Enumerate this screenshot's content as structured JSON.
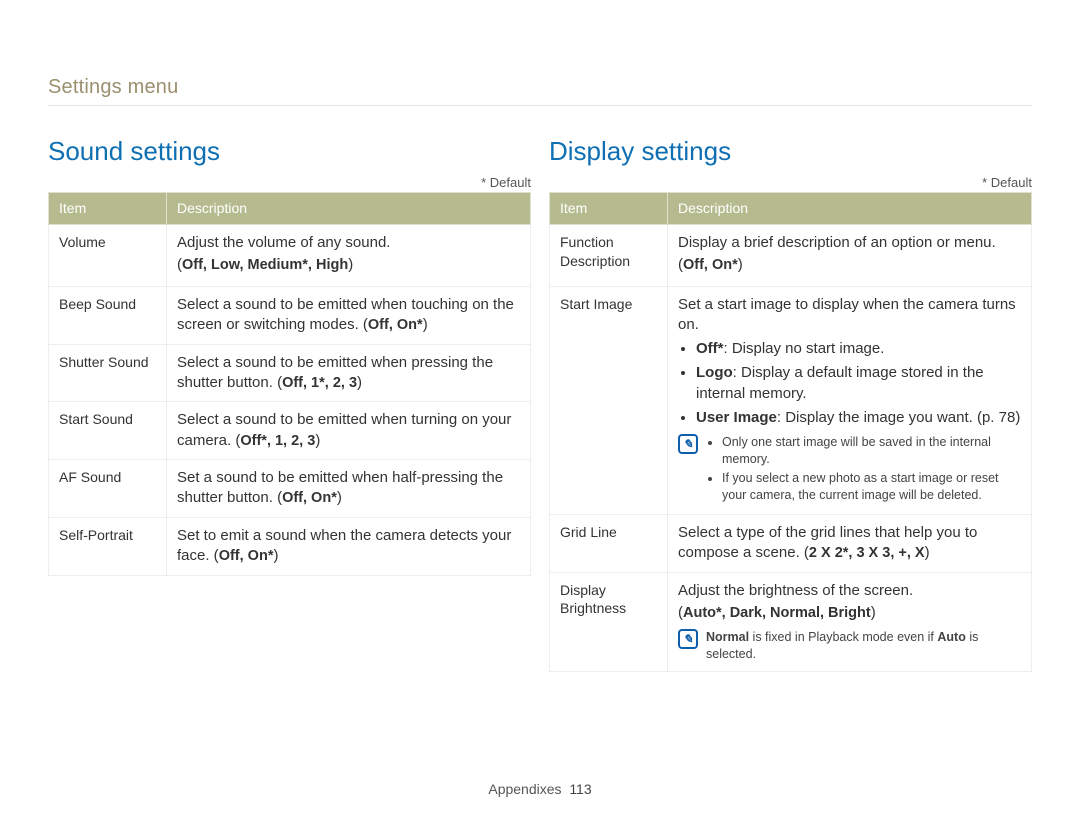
{
  "breadcrumb": "Settings menu",
  "default_label": "* Default",
  "headers": {
    "item": "Item",
    "description": "Description"
  },
  "left": {
    "title": "Sound settings",
    "rows": {
      "volume": {
        "item": "Volume",
        "line1": "Adjust the volume of any sound.",
        "opts_prefix": "(",
        "opts_bold": "Off, Low, Medium*, High",
        "opts_suffix": ")"
      },
      "beep": {
        "item": "Beep Sound",
        "line1": "Select a sound to be emitted when touching on the screen or switching modes. (",
        "opts_bold": "Off, On*",
        "line2": ")"
      },
      "shutter": {
        "item": "Shutter Sound",
        "line1": "Select a sound to be emitted when pressing the shutter button. (",
        "opts_bold": "Off, 1*, 2, 3",
        "line2": ")"
      },
      "start": {
        "item": "Start Sound",
        "line1": "Select a sound to be emitted when turning on your camera. (",
        "opts_bold": "Off*, 1, 2, 3",
        "line2": ")"
      },
      "af": {
        "item": "AF Sound",
        "line1": "Set a sound to be emitted when half-pressing the shutter button. (",
        "opts_bold": "Off, On*",
        "line2": ")"
      },
      "self": {
        "item": "Self-Portrait",
        "line1": "Set to emit a sound when the camera detects your face. (",
        "opts_bold": "Off, On*",
        "line2": ")"
      }
    }
  },
  "right": {
    "title": "Display settings",
    "rows": {
      "func": {
        "item": "Function Description",
        "line1": "Display a brief description of an option or menu.",
        "opts_prefix": "(",
        "opts_bold": "Off, On*",
        "opts_suffix": ")"
      },
      "start_image": {
        "item": "Start Image",
        "line1": "Set a start image to display when the camera turns on.",
        "b_off_label": "Off*",
        "b_off_rest": ": Display no start image.",
        "b_logo_label": "Logo",
        "b_logo_rest": ": Display a default image stored in the internal memory.",
        "b_user_label": "User Image",
        "b_user_rest": ": Display the image you want. (p. 78)",
        "note1": "Only one start image will be saved in the internal memory.",
        "note2": "If you select a new photo as a start image or reset your camera, the current image will be deleted."
      },
      "grid": {
        "item": "Grid Line",
        "line1": "Select a type of the grid lines that help you to compose a scene. (",
        "opts_bold": "2 X 2*, 3 X 3, +, X",
        "line2": ")"
      },
      "brightness": {
        "item": "Display Brightness",
        "line1": "Adjust the brightness of the screen.",
        "opts_prefix": "(",
        "opts_bold": "Auto*, Dark, Normal, Bright",
        "opts_suffix": ")",
        "note_b1": "Normal",
        "note_mid": " is fixed in Playback mode even if ",
        "note_b2": "Auto",
        "note_end": " is selected."
      }
    }
  },
  "footer": {
    "label": "Appendixes",
    "page": "113"
  }
}
